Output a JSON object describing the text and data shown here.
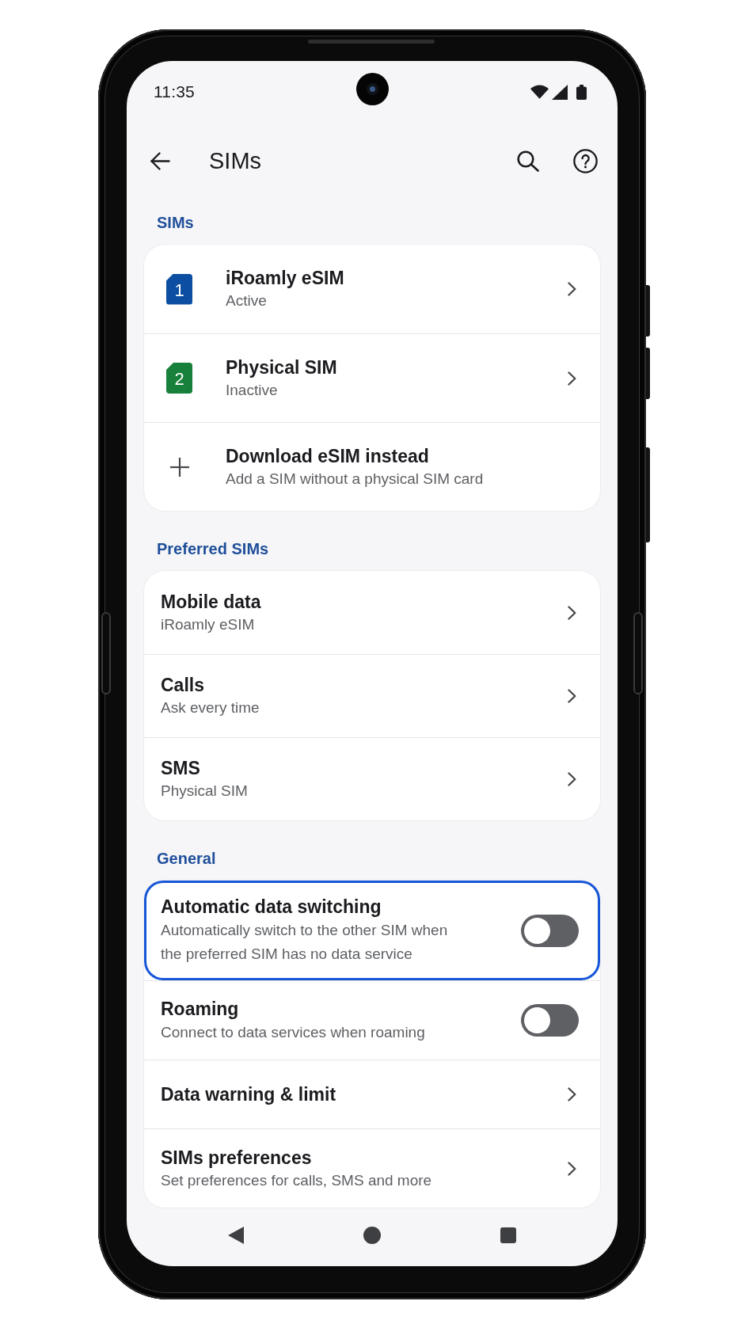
{
  "status_bar": {
    "time": "11:35"
  },
  "app_bar": {
    "title": "SIMs"
  },
  "sections": [
    {
      "header": "SIMs",
      "items": [
        {
          "kind": "sim",
          "number": "1",
          "color": "#0b4ea2",
          "title": "iRoamly eSIM",
          "subtitle": "Active"
        },
        {
          "kind": "sim",
          "number": "2",
          "color": "#17803a",
          "title": "Physical SIM",
          "subtitle": "Inactive"
        },
        {
          "kind": "add",
          "title": "Download eSIM instead",
          "subtitle": "Add a SIM without a physical SIM card"
        }
      ]
    },
    {
      "header": "Preferred SIMs",
      "items": [
        {
          "kind": "link",
          "title": "Mobile data",
          "subtitle": "iRoamly eSIM"
        },
        {
          "kind": "link",
          "title": "Calls",
          "subtitle": "Ask every time"
        },
        {
          "kind": "link",
          "title": "SMS",
          "subtitle": "Physical SIM"
        }
      ]
    },
    {
      "header": "General",
      "items": [
        {
          "kind": "toggle",
          "title": "Automatic data switching",
          "subtitle": "Automatically switch to the other SIM when the preferred SIM has no data service",
          "on": false,
          "focused": true
        },
        {
          "kind": "toggle",
          "title": "Roaming",
          "subtitle": "Connect to data services when roaming",
          "on": false,
          "focused": false
        },
        {
          "kind": "link",
          "title": "Data warning & limit",
          "focused": false
        },
        {
          "kind": "link",
          "title": "SIMs preferences",
          "subtitle": "Set preferences for calls, SMS and more",
          "focused": false
        }
      ]
    }
  ]
}
